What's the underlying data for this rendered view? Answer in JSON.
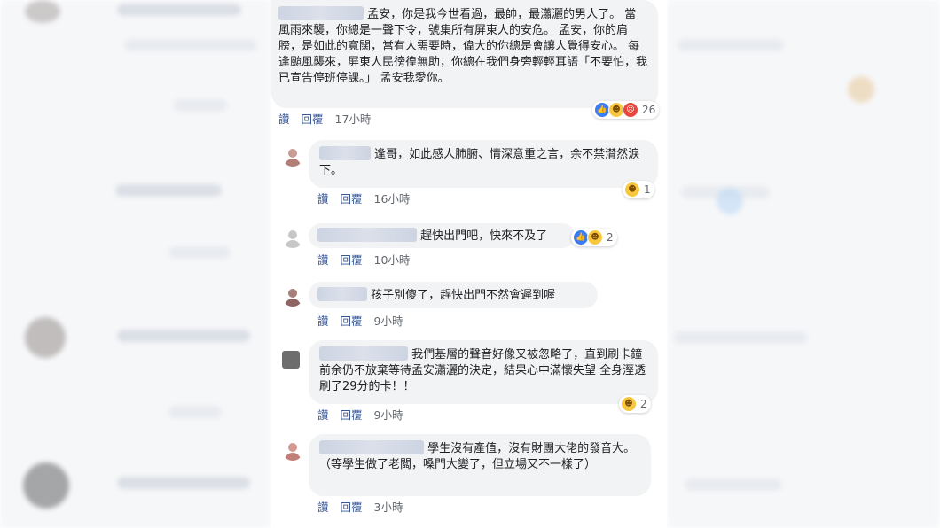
{
  "actions": {
    "like": "讚",
    "reply": "回覆"
  },
  "comments": [
    {
      "text": "孟安，你是我今世看過，最帥，最瀟灑的男人了。 當風雨來襲，你總是一聲下令，號集所有屏東人的安危。 孟安，你的肩膀，是如此的寬闊，當有人需要時，偉大的你總是會讓人覺得安心。 每逢颱風襲來，屏東人民徬徨無助，你總在我們身旁輕輕耳語「不要怕，我已宣告停班停課。」 孟安我愛你。",
      "time": "17小時",
      "reactions": {
        "icons": [
          "like-icon",
          "haha-icon",
          "angry-icon"
        ],
        "count": "26"
      }
    },
    {
      "text": "逢哥，如此感人肺腑、情深意重之言，余不禁潸然淚下。",
      "time": "16小時",
      "reactions": {
        "icons": [
          "haha-icon"
        ],
        "count": "1"
      }
    },
    {
      "text": "趕快出門吧，快來不及了",
      "time": "10小時",
      "reactions": {
        "icons": [
          "like-icon",
          "haha-icon"
        ],
        "count": "2"
      }
    },
    {
      "text": "孩子別傻了，趕快出門不然會遲到喔",
      "time": "9小時",
      "reactions": null
    },
    {
      "text": "我們基層的聲音好像又被忽略了，直到刷卡鐘前余仍不放棄等待孟安瀟灑的決定，結果心中滿懷失望 全身溼透刷了29分的卡！！",
      "time": "9小時",
      "reactions": {
        "icons": [
          "haha-icon"
        ],
        "count": "2"
      }
    },
    {
      "text": "學生沒有產值，沒有財團大佬的發音大。（等學生做了老闆，嗓門大變了，但立場又不一樣了）",
      "time": "3小時",
      "reactions": null
    }
  ]
}
